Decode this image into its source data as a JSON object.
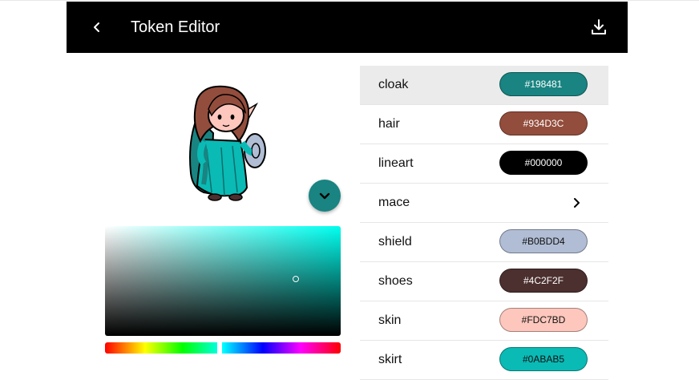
{
  "app": {
    "title": "Token Editor"
  },
  "tokens": [
    {
      "label": "cloak",
      "color": "#198481",
      "text_dark": false,
      "selected": true
    },
    {
      "label": "hair",
      "color": "#934D3C",
      "text_dark": false
    },
    {
      "label": "lineart",
      "color": "#000000",
      "text_dark": false
    },
    {
      "label": "mace",
      "color": null,
      "submenu": true
    },
    {
      "label": "shield",
      "color": "#B0BDD4",
      "text_dark": true
    },
    {
      "label": "shoes",
      "color": "#4C2F2F",
      "text_dark": false
    },
    {
      "label": "skin",
      "color": "#FDC7BD",
      "text_dark": true
    },
    {
      "label": "skirt",
      "color": "#0ABAB5",
      "text_dark": true
    }
  ],
  "icons": {
    "back": "chevron-left-icon",
    "download": "download-icon",
    "collapse": "chevron-down-icon",
    "submenu": "chevron-right-icon"
  },
  "picker": {
    "hue_color": "#00fff0"
  }
}
